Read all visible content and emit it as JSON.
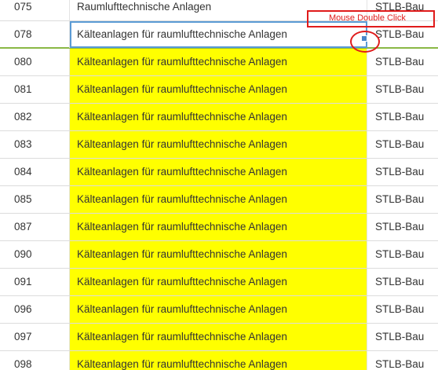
{
  "annotation": {
    "label": "Mouse Double Click",
    "color": "#e01b1b"
  },
  "highlight_color": "#ffff00",
  "rows": [
    {
      "code": "075",
      "name": "Raumlufttechnische Anlagen",
      "source": "STLB-Bau",
      "highlighted": false,
      "selected": false
    },
    {
      "code": "078",
      "name": "Kälteanlagen für raumlufttechnische Anlagen",
      "source": "STLB-Bau",
      "highlighted": false,
      "selected": true
    },
    {
      "code": "080",
      "name": "Kälteanlagen für raumlufttechnische Anlagen",
      "source": "STLB-Bau",
      "highlighted": true,
      "selected": false
    },
    {
      "code": "081",
      "name": "Kälteanlagen für raumlufttechnische Anlagen",
      "source": "STLB-Bau",
      "highlighted": true,
      "selected": false
    },
    {
      "code": "082",
      "name": "Kälteanlagen für raumlufttechnische Anlagen",
      "source": "STLB-Bau",
      "highlighted": true,
      "selected": false
    },
    {
      "code": "083",
      "name": "Kälteanlagen für raumlufttechnische Anlagen",
      "source": "STLB-Bau",
      "highlighted": true,
      "selected": false
    },
    {
      "code": "084",
      "name": "Kälteanlagen für raumlufttechnische Anlagen",
      "source": "STLB-Bau",
      "highlighted": true,
      "selected": false
    },
    {
      "code": "085",
      "name": "Kälteanlagen für raumlufttechnische Anlagen",
      "source": "STLB-Bau",
      "highlighted": true,
      "selected": false
    },
    {
      "code": "087",
      "name": "Kälteanlagen für raumlufttechnische Anlagen",
      "source": "STLB-Bau",
      "highlighted": true,
      "selected": false
    },
    {
      "code": "090",
      "name": "Kälteanlagen für raumlufttechnische Anlagen",
      "source": "STLB-Bau",
      "highlighted": true,
      "selected": false
    },
    {
      "code": "091",
      "name": "Kälteanlagen für raumlufttechnische Anlagen",
      "source": "STLB-Bau",
      "highlighted": true,
      "selected": false
    },
    {
      "code": "096",
      "name": "Kälteanlagen für raumlufttechnische Anlagen",
      "source": "STLB-Bau",
      "highlighted": true,
      "selected": false
    },
    {
      "code": "097",
      "name": "Kälteanlagen für raumlufttechnische Anlagen",
      "source": "STLB-Bau",
      "highlighted": true,
      "selected": false
    },
    {
      "code": "098",
      "name": "Kälteanlagen für raumlufttechnische Anlagen",
      "source": "STLB-Bau",
      "highlighted": true,
      "selected": false
    }
  ]
}
